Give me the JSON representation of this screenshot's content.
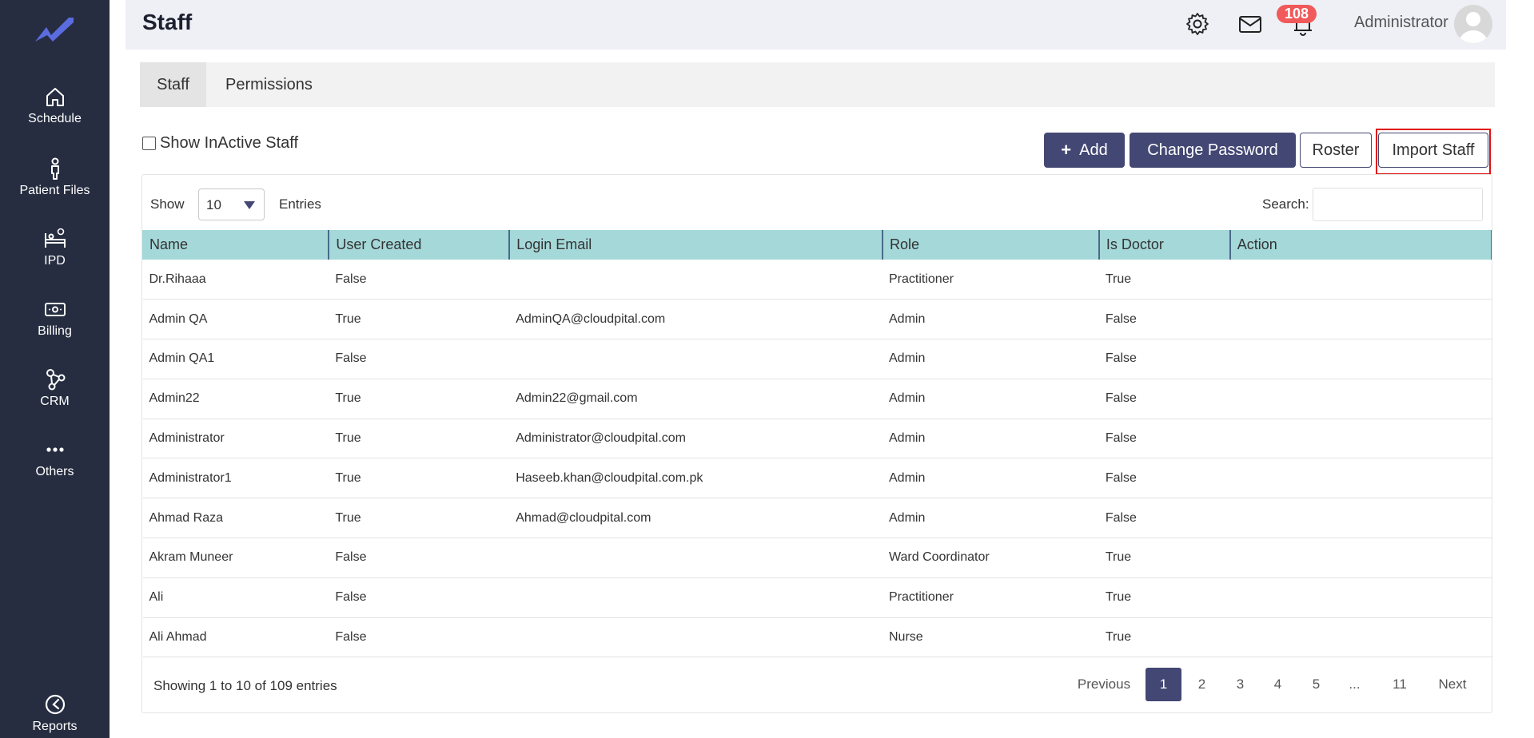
{
  "sidebar": {
    "items": [
      {
        "label": "Schedule",
        "icon": "home-icon"
      },
      {
        "label": "Patient Files",
        "icon": "person-icon"
      },
      {
        "label": "IPD",
        "icon": "bed-icon"
      },
      {
        "label": "Billing",
        "icon": "money-icon"
      },
      {
        "label": "CRM",
        "icon": "share-nodes-icon"
      },
      {
        "label": "Others",
        "icon": "dots-icon"
      },
      {
        "label": "Reports",
        "icon": "gauge-icon"
      }
    ]
  },
  "header": {
    "title": "Staff",
    "notification_count": "108",
    "user_name": "Administrator"
  },
  "tabs": [
    {
      "label": "Staff",
      "active": true
    },
    {
      "label": "Permissions",
      "active": false
    }
  ],
  "toolbar": {
    "inactive_label": "Show InActive Staff",
    "add_label": "Add",
    "change_password_label": "Change Password",
    "roster_label": "Roster",
    "import_label": "Import Staff"
  },
  "table_controls": {
    "show_label": "Show",
    "entries_value": "10",
    "entries_label": "Entries",
    "search_label": "Search:"
  },
  "table": {
    "columns": [
      "Name",
      "User Created",
      "Login Email",
      "Role",
      "Is Doctor",
      "Action"
    ],
    "rows": [
      [
        "Dr.Rihaaa",
        "False",
        "",
        "Practitioner",
        "True",
        ""
      ],
      [
        "Admin QA",
        "True",
        "AdminQA@cloudpital.com",
        "Admin",
        "False",
        ""
      ],
      [
        "Admin QA1",
        "False",
        "",
        "Admin",
        "False",
        ""
      ],
      [
        "Admin22",
        "True",
        "Admin22@gmail.com",
        "Admin",
        "False",
        ""
      ],
      [
        "Administrator",
        "True",
        "Administrator@cloudpital.com",
        "Admin",
        "False",
        ""
      ],
      [
        "Administrator1",
        "True",
        "Haseeb.khan@cloudpital.com.pk",
        "Admin",
        "False",
        ""
      ],
      [
        "Ahmad Raza",
        "True",
        "Ahmad@cloudpital.com",
        "Admin",
        "False",
        ""
      ],
      [
        "Akram Muneer",
        "False",
        "",
        "Ward Coordinator",
        "True",
        ""
      ],
      [
        "Ali",
        "False",
        "",
        "Practitioner",
        "True",
        ""
      ],
      [
        "Ali Ahmad",
        "False",
        "",
        "Nurse",
        "True",
        ""
      ]
    ]
  },
  "pagination": {
    "summary": "Showing 1 to 10 of 109 entries",
    "previous": "Previous",
    "pages": [
      "1",
      "2",
      "3",
      "4",
      "5",
      "...",
      "11"
    ],
    "active_page": "1",
    "next": "Next"
  },
  "colors": {
    "sidebar_bg": "#262d40",
    "primary": "#434773",
    "table_header": "#a5d8d9",
    "badge": "#f05a5a",
    "highlight": "#e01010"
  }
}
